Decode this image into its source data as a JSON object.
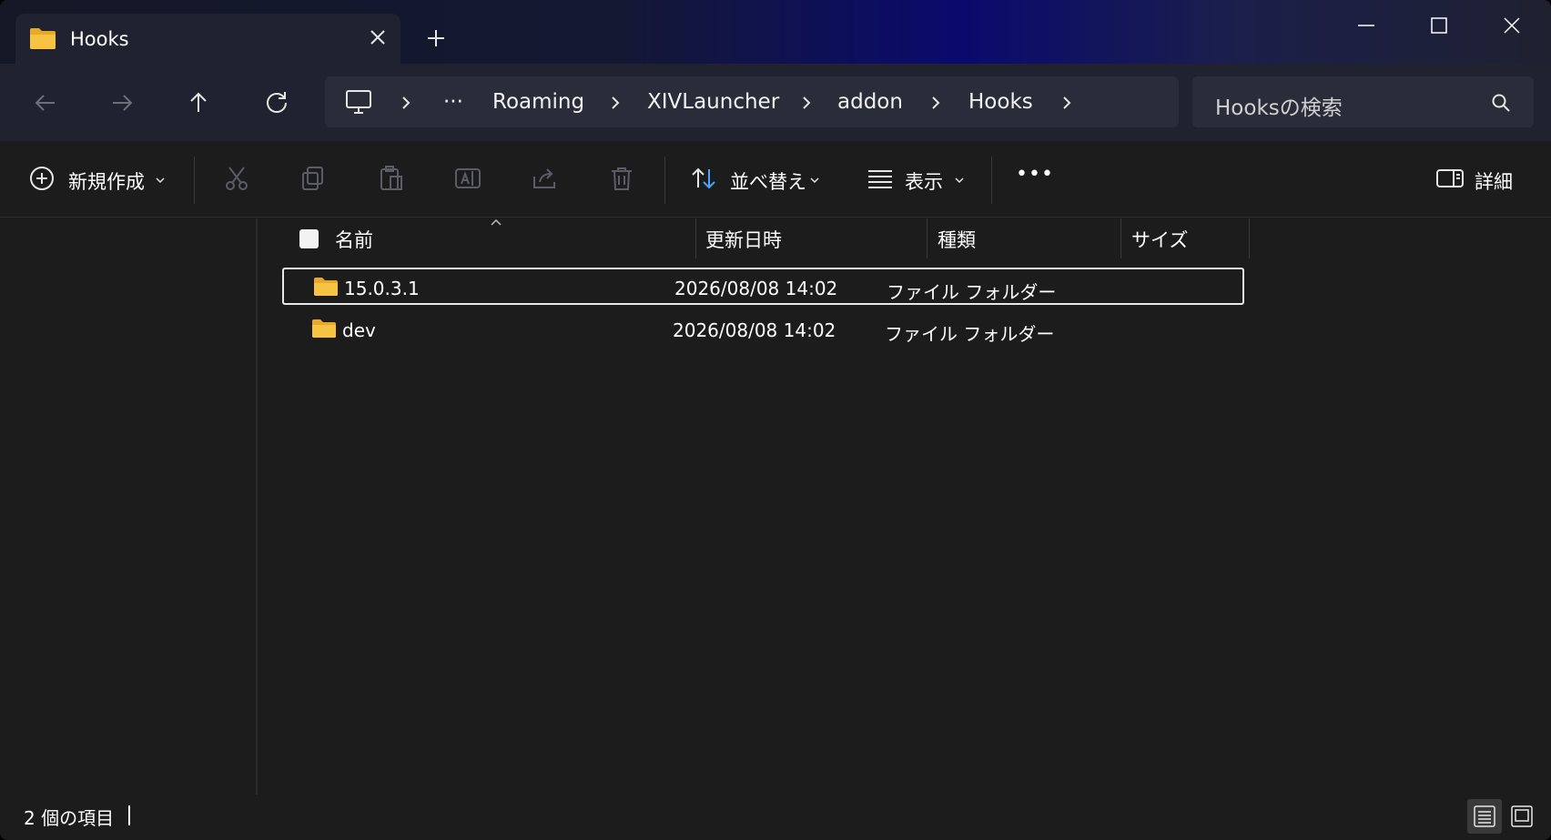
{
  "tab": {
    "title": "Hooks",
    "folder_icon": "folder-icon",
    "close_icon": "close-icon"
  },
  "window": {
    "new_tab_icon": "plus-icon",
    "minimize_icon": "minimize-icon",
    "maximize_icon": "maximize-icon",
    "close_icon": "close-icon"
  },
  "nav": {
    "back_icon": "arrow-left-icon",
    "forward_icon": "arrow-right-icon",
    "up_icon": "arrow-up-icon",
    "refresh_icon": "refresh-icon",
    "breadcrumb": [
      "Roaming",
      "XIVLauncher",
      "addon",
      "Hooks"
    ],
    "overflow": "···"
  },
  "search": {
    "placeholder": "Hooksの検索"
  },
  "toolbar": {
    "new_label": "新規作成",
    "sort_label": "並べ替え",
    "view_label": "表示",
    "more_label": "•••",
    "details_label": "詳細"
  },
  "columns": {
    "name": "名前",
    "modified": "更新日時",
    "type": "種類",
    "size": "サイズ"
  },
  "files": [
    {
      "name": "15.0.3.1",
      "modified": "2026/08/08 14:02",
      "type": "ファイル フォルダー",
      "size": "",
      "selected": true
    },
    {
      "name": "dev",
      "modified": "2026/08/08 14:02",
      "type": "ファイル フォルダー",
      "size": "",
      "selected": false
    }
  ],
  "status": {
    "item_count": "2 個の項目"
  },
  "colors": {
    "folder": "#f6c342",
    "accent": "#0a0a6e",
    "background": "#1c1c1c"
  }
}
